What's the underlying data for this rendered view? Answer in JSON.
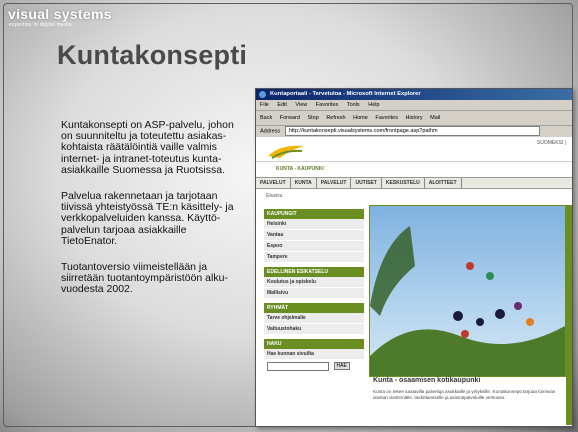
{
  "slide": {
    "brand": "visual systems",
    "tagline": "expertise in digital media",
    "title": "Kuntakonsepti",
    "paragraphs": [
      "Kuntakonsepti on ASP-palvelu, johon on suunniteltu ja toteutettu asiakas-kohtaista räätälöintiä vaille valmis internet- ja intranet-toteutus kunta-asiakkaille Suomessa ja Ruotsissa.",
      "Palvelua rakennetaan ja tarjotaan tiivissä yhteistyössä TE:n käsittely- ja verkkopalveluiden kanssa. Käyttö-palvelun tarjoaa asiakkaille TietoEnator.",
      "Tuotantoversio viimeistellään ja siirretään tuotantoympäristöön alku-vuodesta 2002."
    ]
  },
  "browser": {
    "window_title": "Kuntaportaali - Tervetuloa - Microsoft Internet Explorer",
    "menu": [
      "File",
      "Edit",
      "View",
      "Favorites",
      "Tools",
      "Help"
    ],
    "toolbar": [
      "Back",
      "Forward",
      "Stop",
      "Refresh",
      "Home",
      "Favorites",
      "History",
      "Mail"
    ],
    "address_label": "Address",
    "address_value": "http://kuntakonsepti.visualsystems.com/frontpage.asp?pathm",
    "page": {
      "lang_link": "SUOMEKSI |",
      "logo_text": "KUNTA - KAUPUNKI",
      "nav": [
        "PALVELUT",
        "KUNTA",
        "PALVELUT",
        "UUTISET",
        "KESKUSTELU",
        "ALOITTEET"
      ],
      "breadcrumb": "Etusivu",
      "sidebar": [
        {
          "heading": "KAUPUNGIT",
          "items": [
            "Helsinki",
            "Vantaa",
            "Espoo",
            "Tampere"
          ]
        },
        {
          "heading": "EDELLINEN ESIKATSELU",
          "items": [
            "Koulutus ja opiskelu",
            "Mallisivu"
          ]
        },
        {
          "heading": "RYHMÄT",
          "items": [
            "Tarve ohjelmalle",
            "Valtuustohaku"
          ]
        },
        {
          "heading": "HAKU",
          "items": [
            "Hae kunnan sivuilta"
          ]
        }
      ],
      "search_button": "HAE",
      "hero_caption": "Kunta - osaamisen kotikaupunki",
      "hero_text": "Kunta on tekee saatavilla palveluja asukkaille ja yrityksille. Kuntakonsepti tarjoaa toimivan alustan viestinnälle, tiedottamiselle ja asiointipalveluille verkossa."
    }
  }
}
